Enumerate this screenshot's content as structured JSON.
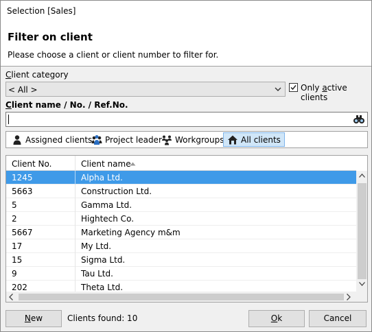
{
  "window": {
    "title": "Selection [Sales]"
  },
  "header": {
    "heading": "Filter on client",
    "description": "Please choose a client or client number to filter for."
  },
  "category": {
    "label": "Client category",
    "selected": "< All >",
    "only_active_label": "Only active clients",
    "only_active_checked": true
  },
  "search": {
    "label": "Client name / No. / Ref.No.",
    "value": ""
  },
  "tabs": [
    {
      "label": "Assigned clients",
      "icon": "person-icon"
    },
    {
      "label": "Project leader",
      "icon": "people-icon"
    },
    {
      "label": "Workgroups",
      "icon": "group-icon"
    },
    {
      "label": "All clients",
      "icon": "home-icon",
      "active": true
    }
  ],
  "grid": {
    "columns": [
      "Client No.",
      "Client name"
    ],
    "sort_column": "Client name",
    "sort_direction": "ascending",
    "rows": [
      {
        "no": "1245",
        "name": "Alpha Ltd.",
        "selected": true
      },
      {
        "no": "5663",
        "name": "Construction Ltd."
      },
      {
        "no": "5",
        "name": "Gamma Ltd."
      },
      {
        "no": "2",
        "name": "Hightech Co."
      },
      {
        "no": "5667",
        "name": "Marketing Agency m&m"
      },
      {
        "no": "17",
        "name": "My Ltd."
      },
      {
        "no": "15",
        "name": "Sigma Ltd."
      },
      {
        "no": "9",
        "name": "Tau Ltd."
      },
      {
        "no": "202",
        "name": "Theta Ltd."
      }
    ]
  },
  "footer": {
    "new_label": "New",
    "clients_found": "Clients found: 10",
    "ok_label": "Ok",
    "cancel_label": "Cancel"
  }
}
